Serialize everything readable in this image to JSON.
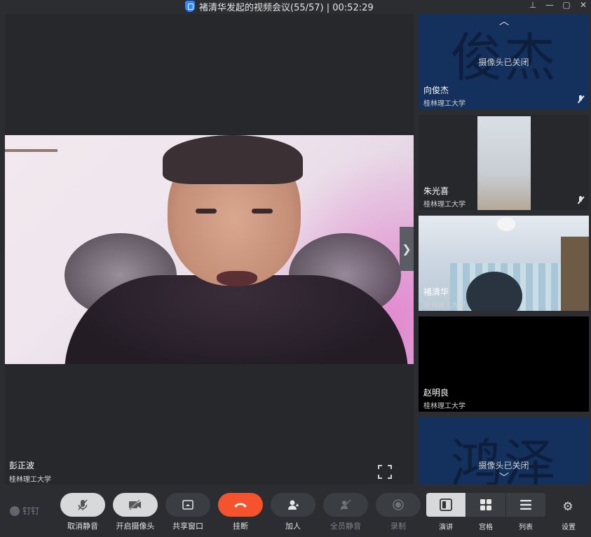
{
  "window": {
    "title": "褚清华发起的视频会议(55/57) | 00:52:29",
    "pin_icon": "pin-icon",
    "min_icon": "minimize-icon",
    "max_icon": "maximize-icon",
    "close_icon": "close-icon"
  },
  "stage": {
    "speaker_name": "彭正波",
    "speaker_org": "桂林理工大学"
  },
  "tiles": [
    {
      "avatar_text": "俊杰",
      "camera_status": "摄像头已关闭",
      "name": "向俊杰",
      "org": "桂林理工大学",
      "muted": true
    },
    {
      "name": "朱光喜",
      "org": "桂林理工大学",
      "muted": true
    },
    {
      "name": "褚清华",
      "org": "桂林理工大学",
      "muted": false
    },
    {
      "name": "赵明良",
      "org": "桂林理工大学",
      "muted": false
    },
    {
      "avatar_text": "鸿泽",
      "camera_status": "摄像头已关闭"
    }
  ],
  "toolbar": {
    "logo": "钉钉",
    "buttons": [
      {
        "label": "取消静音",
        "icon": "mic-off-icon"
      },
      {
        "label": "开启摄像头",
        "icon": "camera-off-icon"
      },
      {
        "label": "共享窗口",
        "icon": "share-screen-icon"
      },
      {
        "label": "挂断",
        "icon": "hang-up-icon"
      },
      {
        "label": "加人",
        "icon": "add-person-icon"
      },
      {
        "label": "全员静音",
        "icon": "mute-all-icon"
      },
      {
        "label": "录制",
        "icon": "record-icon"
      }
    ],
    "views": [
      {
        "label": "演讲",
        "icon": "speaker-view-icon",
        "active": true
      },
      {
        "label": "宫格",
        "icon": "grid-view-icon",
        "active": false
      },
      {
        "label": "列表",
        "icon": "list-view-icon",
        "active": false
      }
    ],
    "settings_label": "设置",
    "colors": {
      "hangup": "#f4532e",
      "tile_navy": "#14305c"
    }
  }
}
